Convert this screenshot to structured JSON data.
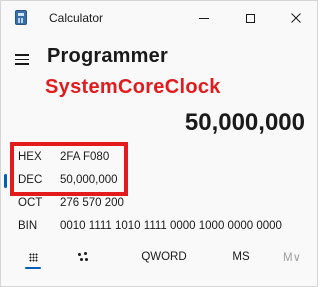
{
  "window": {
    "title": "Calculator"
  },
  "header": {
    "mode": "Programmer",
    "annotation": "SystemCoreClock"
  },
  "display": {
    "value": "50,000,000"
  },
  "radix": [
    {
      "label": "HEX",
      "value": "2FA F080"
    },
    {
      "label": "DEC",
      "value": "50,000,000"
    },
    {
      "label": "OCT",
      "value": "276 570 200"
    },
    {
      "label": "BIN",
      "value": "0010 1111 1010 1111 0000 1000 0000 0000"
    }
  ],
  "active_radix": "DEC",
  "toolbar": {
    "word_size": "QWORD",
    "memory_store": "MS",
    "memory_dropdown": "M∨"
  },
  "colors": {
    "annotation": "#e21c1c",
    "accent": "#005fb8"
  }
}
